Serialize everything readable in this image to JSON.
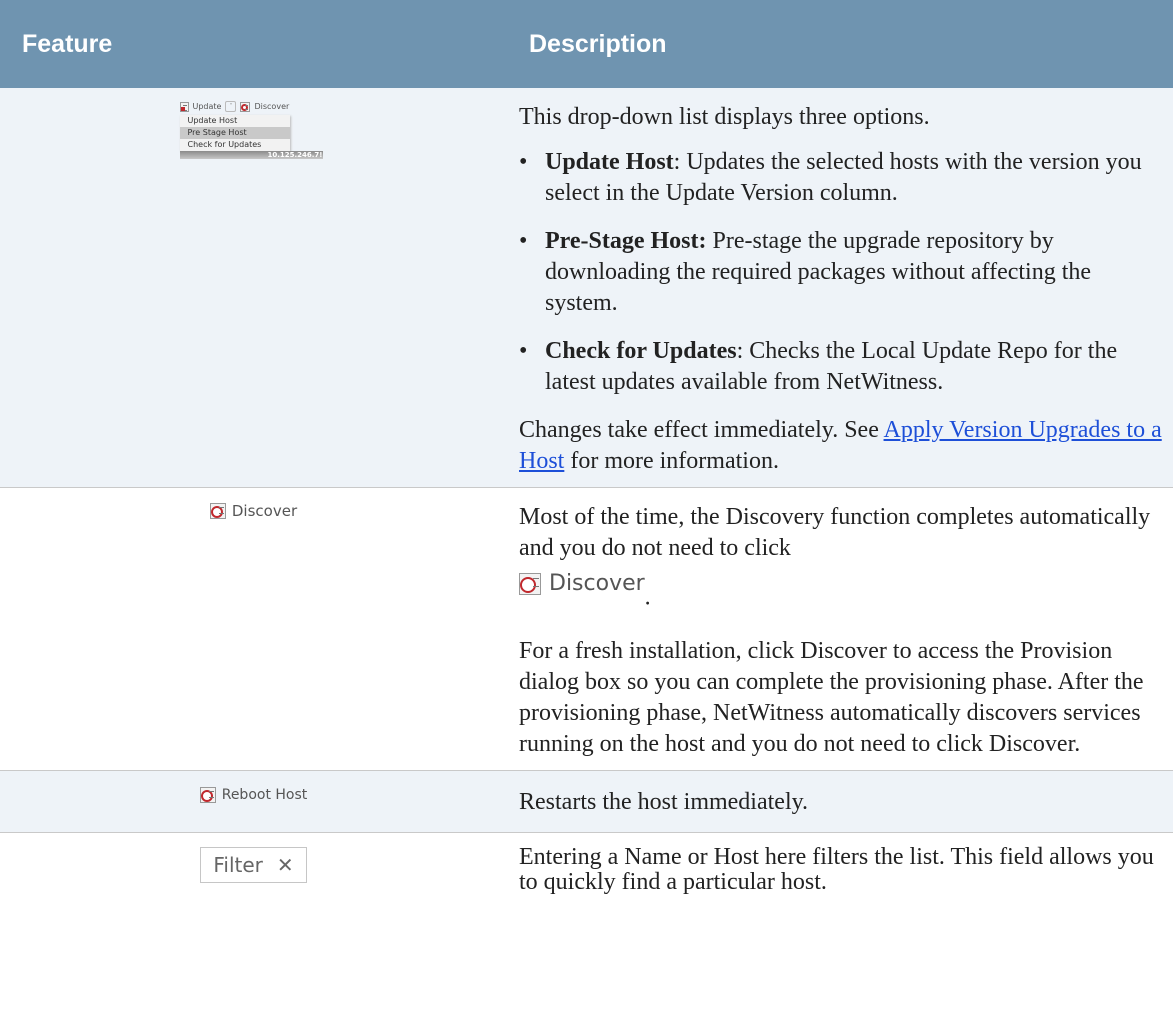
{
  "header": {
    "feature": "Feature",
    "description": "Description"
  },
  "rows": {
    "update": {
      "ui": {
        "update_label": "Update",
        "discover_label": "Discover",
        "menu_items": [
          "Update Host",
          "Pre Stage Host",
          "Check for Updates"
        ],
        "ip": "10.125.246.7!"
      },
      "intro": "This drop-down list displays three options.",
      "options": [
        {
          "term": "Update Host",
          "sep": ":",
          "text": " Updates the selected hosts with the version you select in the Update Version column."
        },
        {
          "term": "Pre-Stage Host:",
          "sep": "",
          "text": " Pre-stage the upgrade repository by downloading the required packages without affecting the system."
        },
        {
          "term": "Check for Updates",
          "sep": ":",
          "text": " Checks the Local Update Repo for the latest updates available from NetWitness."
        }
      ],
      "outro_before": "Changes take effect immediately. See ",
      "link": "Apply Version Upgrades to a Host",
      "outro_after": " for more information."
    },
    "discover": {
      "ui_label": "Discover",
      "p1": "Most of the time, the Discovery function completes automatically and you do not need to click",
      "inline_button_label": "Discover",
      "period": ".",
      "p2": "For a fresh installation, click Discover to access the Provision dialog box so you can complete the provisioning phase. After the provisioning phase, NetWitness automatically discovers services running on the host and you do not need to click Discover."
    },
    "reboot": {
      "ui_label": "Reboot Host",
      "text": "Restarts the host immediately."
    },
    "filter": {
      "placeholder": "Filter",
      "clear_glyph": "✕",
      "text": "Entering a Name or Host here filters the list. This field allows you to quickly find a particular host."
    }
  },
  "colors": {
    "header_bg": "#6f94b0",
    "alt_row_bg": "#eef3f8",
    "link": "#1d4fd8",
    "icon_red": "#c0282d"
  }
}
